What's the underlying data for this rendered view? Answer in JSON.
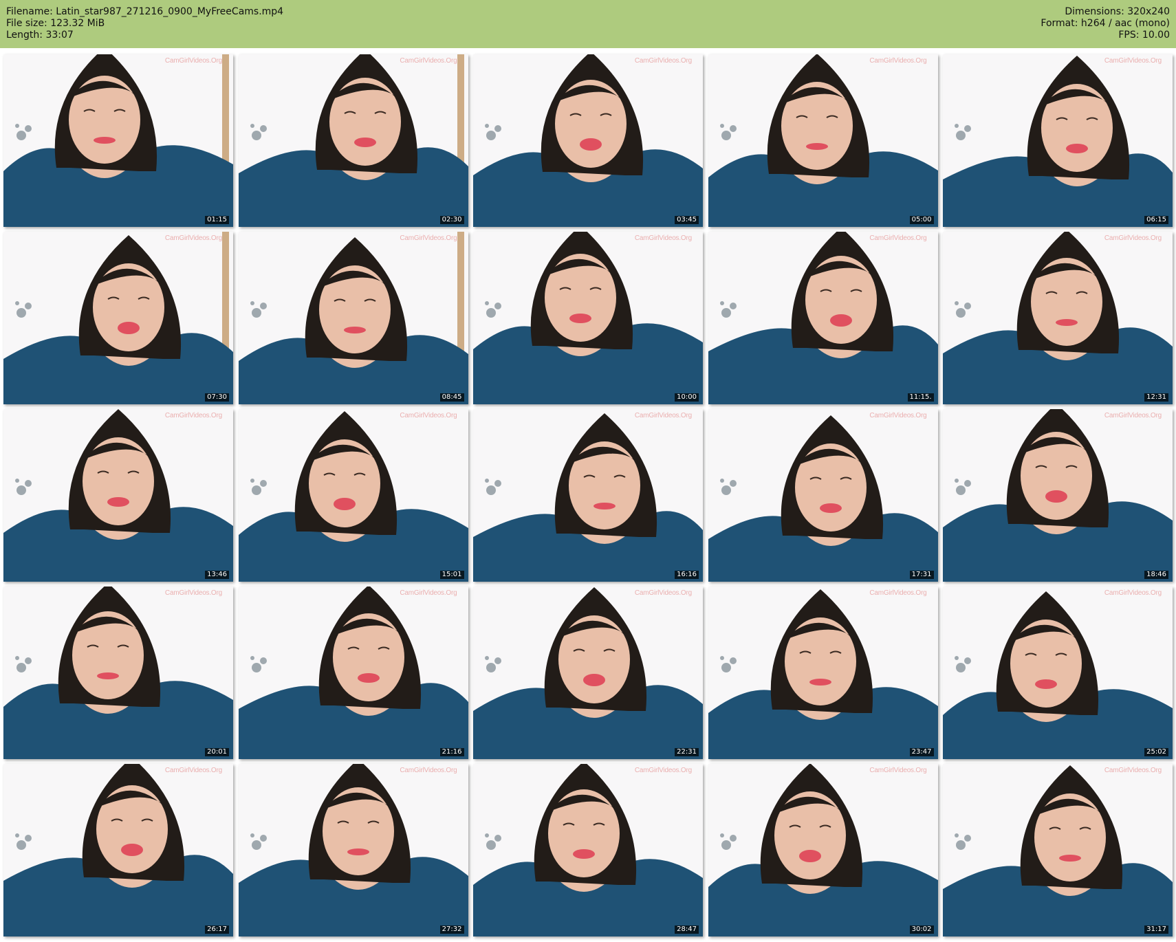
{
  "header": {
    "filename": "Filename: Latin_star987_271216_0900_MyFreeCams.mp4",
    "file_size": "File size: 123.32 MiB",
    "length": "Length: 33:07",
    "dimensions": "Dimensions: 320x240",
    "format": "Format: h264 / aac (mono)",
    "fps": "FPS: 10.00"
  },
  "colors": {
    "header_bg": "#aecb7e",
    "top": "#1f5275",
    "hair": "#221c18",
    "skin": "#e9bfa8",
    "lips": "#e0505f"
  },
  "watermark": "CamGirlVideos.Org",
  "thumbnails": [
    {
      "time": "01:15"
    },
    {
      "time": "02:30"
    },
    {
      "time": "03:45"
    },
    {
      "time": "05:00"
    },
    {
      "time": "06:15"
    },
    {
      "time": "07:30"
    },
    {
      "time": "08:45"
    },
    {
      "time": "10:00"
    },
    {
      "time": "11:15."
    },
    {
      "time": "12:31"
    },
    {
      "time": "13:46"
    },
    {
      "time": "15:01"
    },
    {
      "time": "16:16"
    },
    {
      "time": "17:31"
    },
    {
      "time": "18:46"
    },
    {
      "time": "20:01"
    },
    {
      "time": "21:16"
    },
    {
      "time": "22:31"
    },
    {
      "time": "23:47"
    },
    {
      "time": "25:02"
    },
    {
      "time": "26:17"
    },
    {
      "time": "27:32"
    },
    {
      "time": "28:47"
    },
    {
      "time": "30:02"
    },
    {
      "time": "31:17"
    }
  ]
}
